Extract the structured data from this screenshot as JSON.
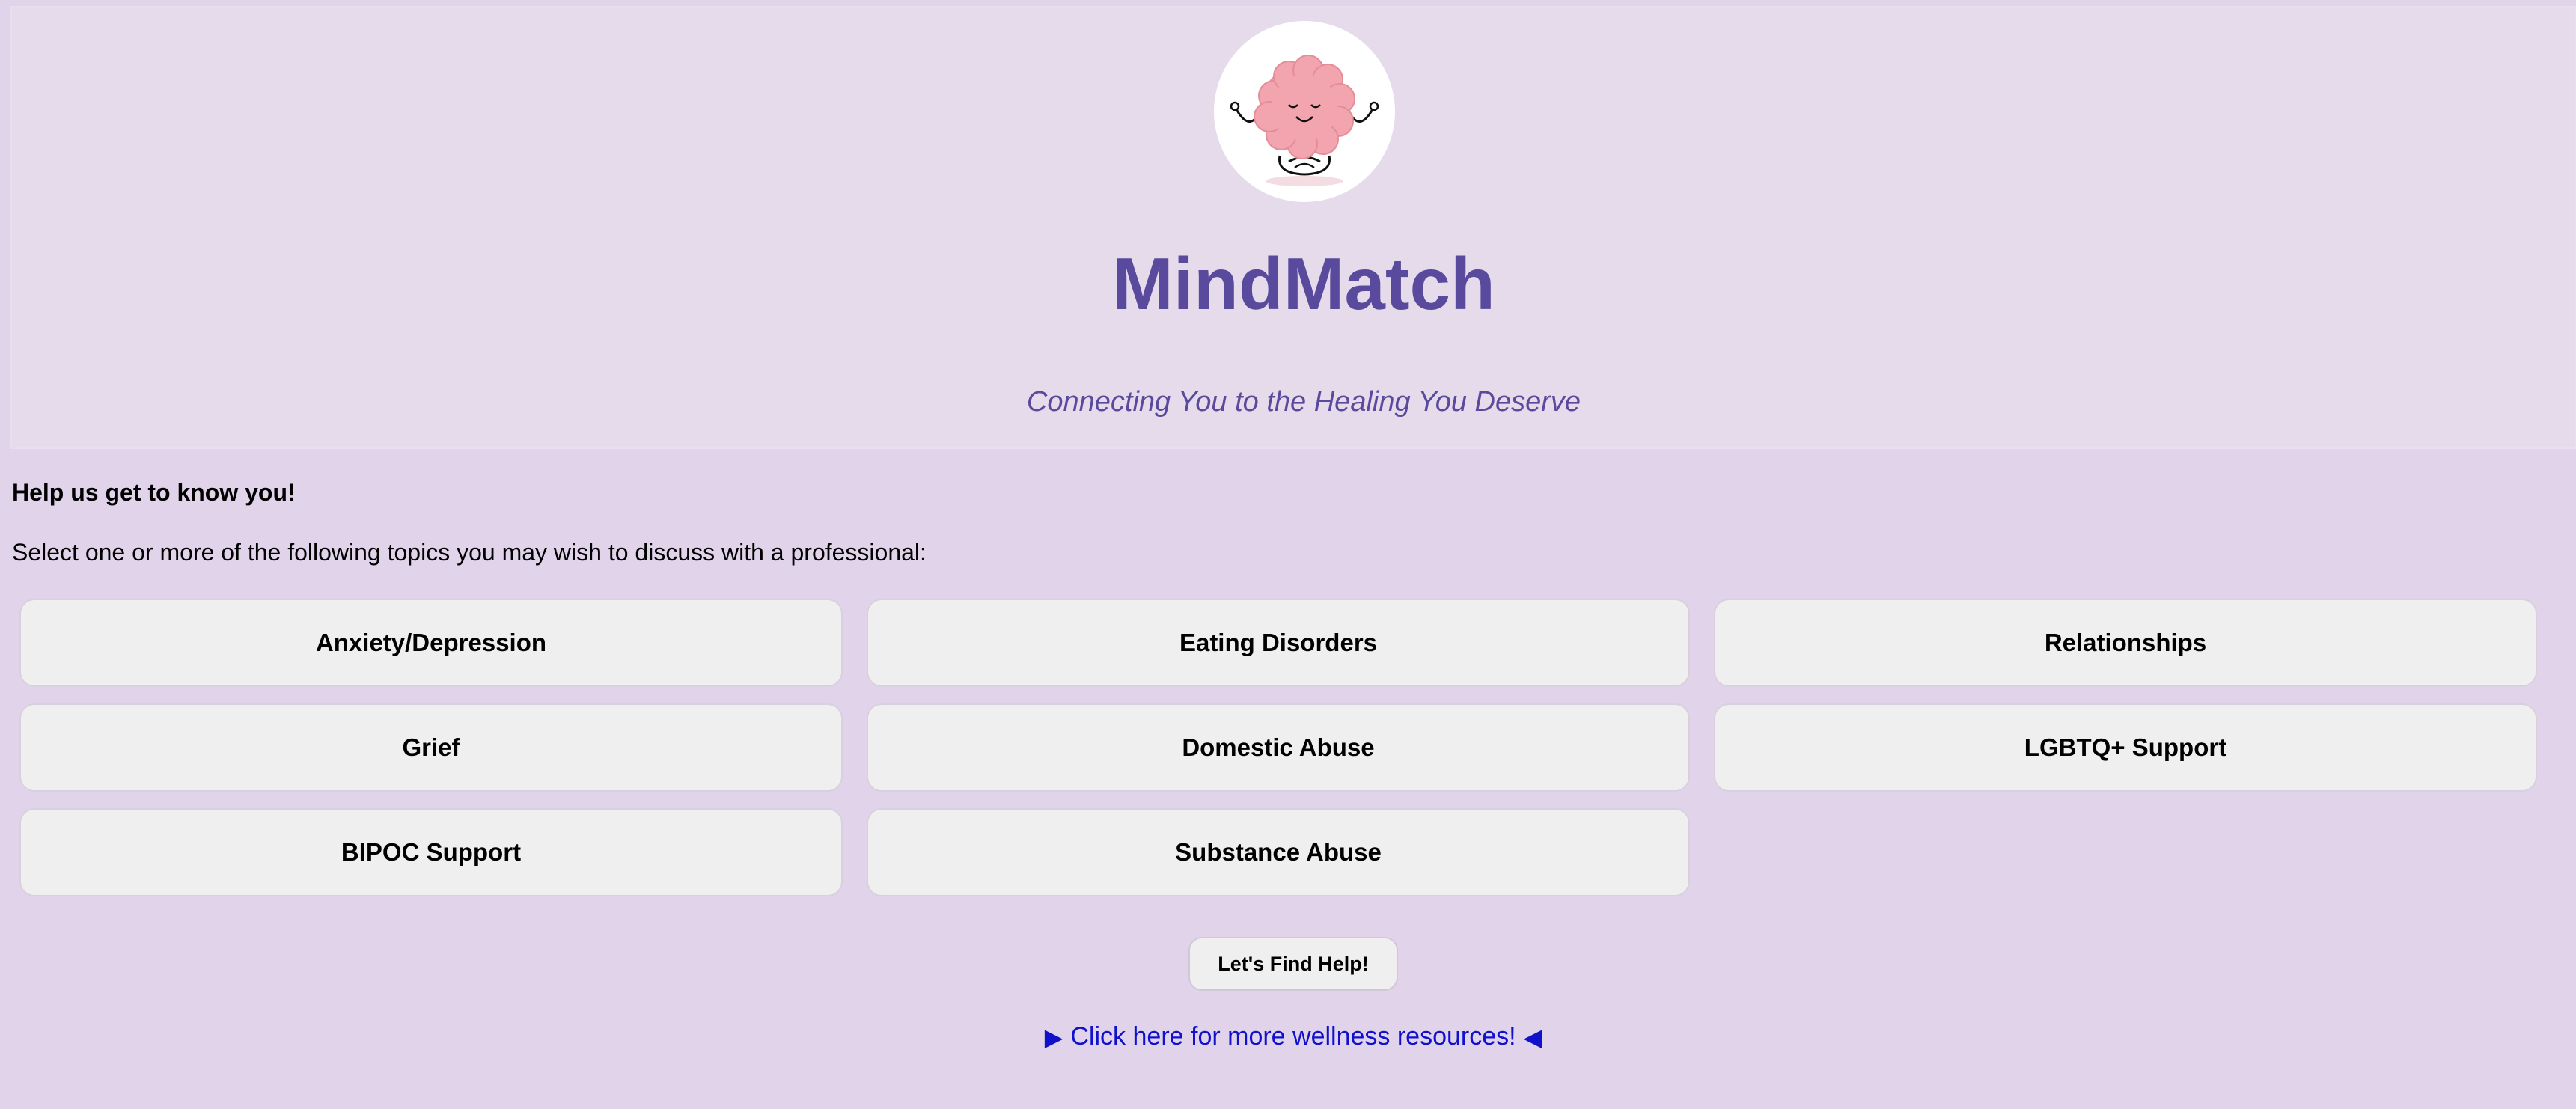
{
  "header": {
    "logo_icon": "meditating-brain-icon",
    "title": "MindMatch",
    "subtitle": "Connecting You to the Healing You Deserve"
  },
  "intro": {
    "heading": "Help us get to know you!",
    "instruction": "Select one or more of the following topics you may wish to discuss with a professional:"
  },
  "topics": [
    "Anxiety/Depression",
    "Eating Disorders",
    "Relationships",
    "Grief",
    "Domestic Abuse",
    "LGBTQ+ Support",
    "BIPOC Support",
    "Substance Abuse"
  ],
  "actions": {
    "find_help_label": "Let's Find Help!",
    "resources_link": "Click here for more wellness resources!",
    "resources_arrow_left": "▶",
    "resources_arrow_right": "◀"
  },
  "colors": {
    "background": "#e1d4ea",
    "title": "#5a4a9d",
    "link": "#1111cc"
  }
}
